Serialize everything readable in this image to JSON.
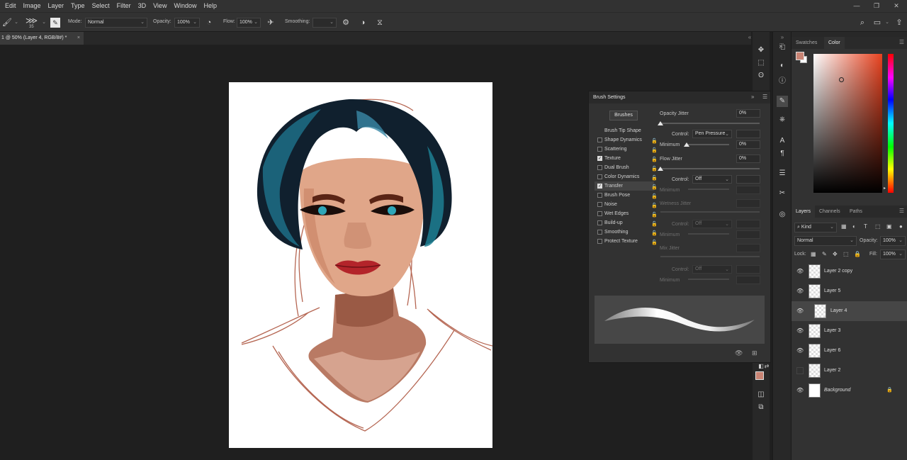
{
  "menu": {
    "items": [
      "Edit",
      "Image",
      "Layer",
      "Type",
      "Select",
      "Filter",
      "3D",
      "View",
      "Window",
      "Help"
    ]
  },
  "options_bar": {
    "brush_size": "35",
    "mode_label": "Mode:",
    "mode_value": "Normal",
    "opacity_label": "Opacity:",
    "opacity_value": "100%",
    "flow_label": "Flow:",
    "flow_value": "100%",
    "smoothing_label": "Smoothing:",
    "smoothing_value": ""
  },
  "document": {
    "tab_title": "1 @ 50% (Layer 4, RGB/8#) *",
    "close_glyph": "×"
  },
  "color_panel": {
    "tabs": [
      "Swatches",
      "Color"
    ],
    "active_tab": "Color",
    "foreground": "#c98474",
    "background": "#ffffff"
  },
  "layers_panel": {
    "tabs": [
      "Layers",
      "Channels",
      "Paths"
    ],
    "kind_label": "Kind",
    "blend_mode": "Normal",
    "opacity_label": "Opacity:",
    "opacity_value": "100%",
    "lock_label": "Lock:",
    "fill_label": "Fill:",
    "fill_value": "100%",
    "layers": [
      {
        "name": "Layer 2 copy",
        "visible": true,
        "selected": false,
        "italic": false
      },
      {
        "name": "Layer 5",
        "visible": true,
        "selected": false,
        "italic": false
      },
      {
        "name": "Layer 4",
        "visible": true,
        "selected": true,
        "italic": false
      },
      {
        "name": "Layer 3",
        "visible": true,
        "selected": false,
        "italic": false
      },
      {
        "name": "Layer 6",
        "visible": true,
        "selected": false,
        "italic": false
      },
      {
        "name": "Layer 2",
        "visible": false,
        "selected": false,
        "italic": false
      },
      {
        "name": "Background",
        "visible": true,
        "selected": false,
        "italic": true
      }
    ]
  },
  "brush_settings": {
    "title": "Brush Settings",
    "brushes_button": "Brushes",
    "section_header": "Brush Tip Shape",
    "items": [
      {
        "label": "Shape Dynamics",
        "checked": false
      },
      {
        "label": "Scattering",
        "checked": false
      },
      {
        "label": "Texture",
        "checked": true
      },
      {
        "label": "Dual Brush",
        "checked": false
      },
      {
        "label": "Color Dynamics",
        "checked": false
      },
      {
        "label": "Transfer",
        "checked": true,
        "active": true
      },
      {
        "label": "Brush Pose",
        "checked": false
      },
      {
        "label": "Noise",
        "checked": false
      },
      {
        "label": "Wet Edges",
        "checked": false
      },
      {
        "label": "Build-up",
        "checked": false
      },
      {
        "label": "Smoothing",
        "checked": false
      },
      {
        "label": "Protect Texture",
        "checked": false
      }
    ],
    "opacity_jitter_label": "Opacity Jitter",
    "opacity_jitter_value": "0%",
    "control_label": "Control:",
    "control1_value": "Pen Pressure",
    "minimum_label": "Minimum",
    "minimum1_value": "0%",
    "flow_jitter_label": "Flow Jitter",
    "flow_jitter_value": "0%",
    "control2_value": "Off",
    "wetness_jitter_label": "Wetness Jitter",
    "control3_value": "Off",
    "mix_jitter_label": "Mix Jitter",
    "control4_value": "Off"
  }
}
